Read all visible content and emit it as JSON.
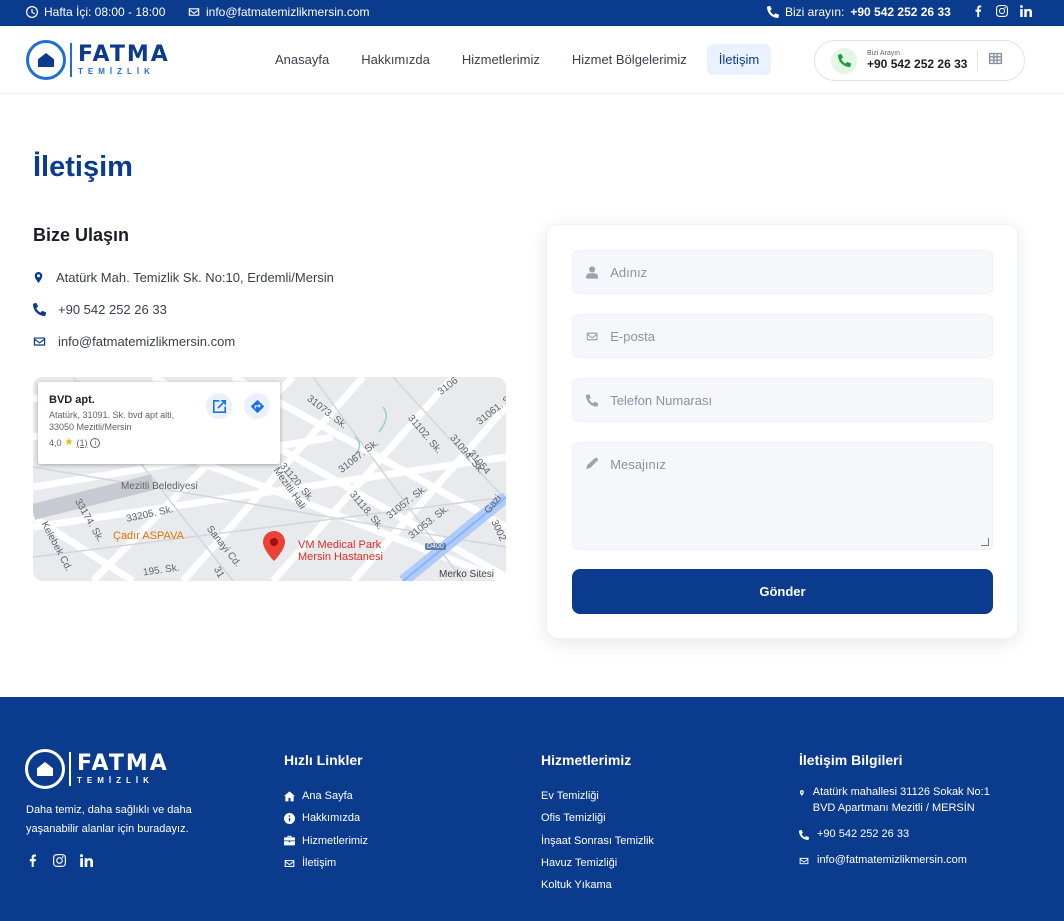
{
  "topbar": {
    "hours": "Hafta İçi: 08:00 - 18:00",
    "email": "info@fatmatemizlikmersin.com",
    "call_label": "Bizi arayın:",
    "call_number": "+90 542 252 26 33"
  },
  "brand": {
    "name": "FATMA",
    "sub": "TEMİZLİK",
    "color": "#0b3b8c",
    "accent": "#1e6fd0"
  },
  "nav": {
    "items": [
      {
        "label": "Anasayfa"
      },
      {
        "label": "Hakkımızda"
      },
      {
        "label": "Hizmetlerimiz"
      },
      {
        "label": "Hizmet Bölgelerimiz"
      },
      {
        "label": "İletişim",
        "active": true
      }
    ],
    "call_label": "Bizi Arayın",
    "call_number": "+90 542 252 26 33"
  },
  "main": {
    "title": "İletişim",
    "subtitle": "Bize Ulaşın",
    "address": "Atatürk Mah. Temizlik Sk. No:10, Erdemli/Mersin",
    "phone": "+90 542 252 26 33",
    "email": "info@fatmatemizlikmersin.com"
  },
  "map": {
    "card_title": "BVD apt.",
    "card_address": "Atatürk, 31091. Sk. bvd apt alti, 33050 Mezitli/Mersin",
    "rating": "4,0",
    "review_count": "(1)",
    "labels": {
      "belediye": "Mezitli Belediyesi",
      "aspava": "Çadır ASPAVA",
      "hospital": "VM Medical Park Mersin Hastanesi",
      "merko": "Merko Sitesi",
      "hal": "Mezitli Hali",
      "road": "D400",
      "streets": [
        "31073. Sk.",
        "31067. Sk.",
        "31102. Sk.",
        "31094. Sk.",
        "31120. Sk.",
        "31118. Sk.",
        "31057. Sk.",
        "31053. Sk.",
        "33205. Sk.",
        "33174. Sk.",
        "Sanayi Cd.",
        "Gazi",
        "Kelebek Cd.",
        "31061. Sk.",
        "3106",
        "3002",
        "31054",
        "195. Sk.",
        "31"
      ]
    }
  },
  "form": {
    "name_placeholder": "Adınız",
    "email_placeholder": "E-posta",
    "phone_placeholder": "Telefon Numarası",
    "message_placeholder": "Mesajınız",
    "submit_label": "Gönder"
  },
  "footer": {
    "tagline": "Daha temiz, daha sağlıklı ve daha yaşanabilir alanlar için buradayız.",
    "quick_links_title": "Hızlı Linkler",
    "quick_links": [
      "Ana Sayfa",
      "Hakkımızda",
      "Hizmetlerimiz",
      "İletişim"
    ],
    "services_title": "Hizmetlerimiz",
    "services": [
      "Ev Temizliği",
      "Ofis Temizliği",
      "İnşaat Sonrası Temizlik",
      "Havuz Temizliği",
      "Koltuk Yıkama"
    ],
    "contact_title": "İletişim Bilgileri",
    "contact_address": "Atatürk mahallesi 31126 Sokak No:1 BVD Apartmanı Mezitli / MERSİN",
    "contact_phone": "+90 542 252 26 33",
    "contact_email": "info@fatmatemizlikmersin.com"
  }
}
